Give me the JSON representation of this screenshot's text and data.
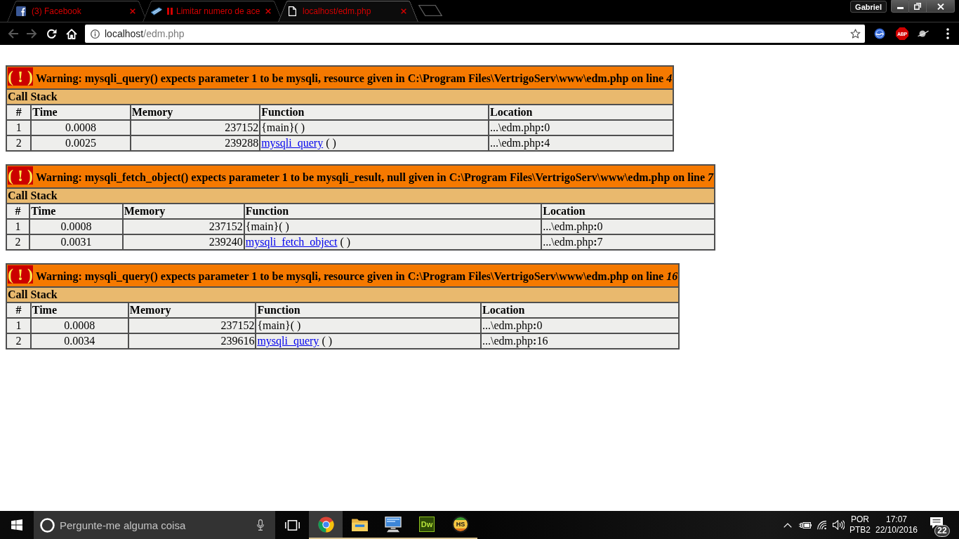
{
  "browser": {
    "tabs": [
      {
        "title": "(3) Facebook",
        "kind": "social",
        "selected": false
      },
      {
        "title": "Limitar numero de ace",
        "kind": "playing",
        "selected": false
      },
      {
        "title": "localhost/edm.php",
        "kind": "document",
        "selected": true
      }
    ],
    "profile": "Gabriel",
    "toolbar": {
      "back_disabled": true,
      "forward_disabled": true
    },
    "address": {
      "host": "localhost",
      "path": "/edm.php"
    },
    "extensions": [
      {
        "kind": "globe"
      },
      {
        "kind": "blocker",
        "label": "ABP"
      },
      {
        "kind": "planet"
      }
    ]
  },
  "page": {
    "errors": [
      {
        "marker": "( ! )",
        "message": "Warning: mysqli_query() expects parameter 1 to be mysqli, resource given in C:\\Program Files\\VertrigoServ\\www\\edm.php on line *4*",
        "stack_title": "Call Stack",
        "columns": [
          "#",
          "Time",
          "Memory",
          "Function",
          "Location"
        ],
        "rows": [
          {
            "index": "1",
            "time": "0.0008",
            "memory": "237152",
            "function": {
              "text": "{main}( )"
            },
            "location": "...\\edm.php**:**0"
          },
          {
            "index": "2",
            "time": "0.0025",
            "memory": "239288",
            "function": {
              "link": "mysqli_query",
              "suffix": "( )"
            },
            "location": "...\\edm.php**:**4"
          }
        ]
      },
      {
        "marker": "( ! )",
        "message": "Warning: mysqli_fetch_object() expects parameter 1 to be mysqli_result, null given in C:\\Program Files\\VertrigoServ\\www\\edm.php on line *7*",
        "stack_title": "Call Stack",
        "columns": [
          "#",
          "Time",
          "Memory",
          "Function",
          "Location"
        ],
        "rows": [
          {
            "index": "1",
            "time": "0.0008",
            "memory": "237152",
            "function": {
              "text": "{main}( )"
            },
            "location": "...\\edm.php**:**0"
          },
          {
            "index": "2",
            "time": "0.0031",
            "memory": "239240",
            "function": {
              "link": "mysqli_fetch_object",
              "suffix": "( )"
            },
            "location": "...\\edm.php**:**7"
          }
        ]
      },
      {
        "marker": "( ! )",
        "message": "Warning: mysqli_query() expects parameter 1 to be mysqli, resource given in C:\\Program Files\\VertrigoServ\\www\\edm.php on line *16*",
        "stack_title": "Call Stack",
        "columns": [
          "#",
          "Time",
          "Memory",
          "Function",
          "Location"
        ],
        "rows": [
          {
            "index": "1",
            "time": "0.0008",
            "memory": "237152",
            "function": {
              "text": "{main}( )"
            },
            "location": "...\\edm.php**:**0"
          },
          {
            "index": "2",
            "time": "0.0034",
            "memory": "239616",
            "function": {
              "link": "mysqli_query",
              "suffix": "( )"
            },
            "location": "...\\edm.php**:**16"
          }
        ]
      }
    ]
  },
  "taskbar": {
    "search": {
      "placeholder": "Pergunte-me alguma coisa"
    },
    "apps": [
      {
        "kind": "chrome",
        "selected": true,
        "running": true
      },
      {
        "kind": "explorer",
        "selected": false,
        "running": true
      },
      {
        "kind": "network",
        "selected": false,
        "running": true
      },
      {
        "kind": "dreamweaver",
        "label": "Dw",
        "selected": false,
        "running": true
      },
      {
        "kind": "hs",
        "label": "HS",
        "selected": false,
        "running": true
      }
    ],
    "tray": {
      "language": "POR",
      "layout": "PTB2",
      "time": "17:07",
      "date": "22/10/2016",
      "notifications": "22"
    }
  }
}
